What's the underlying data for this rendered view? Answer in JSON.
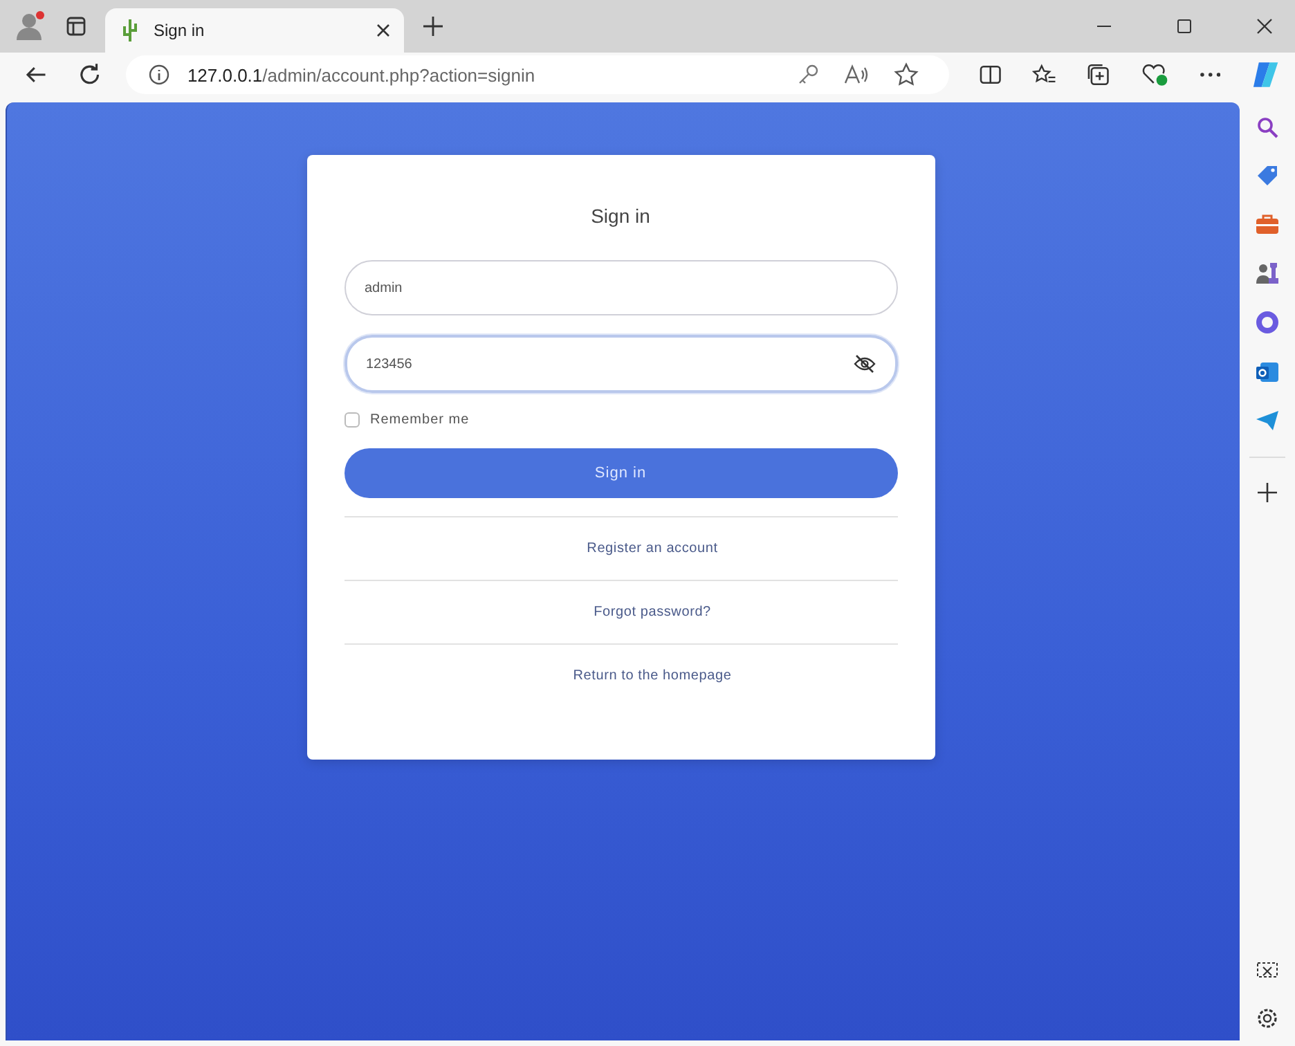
{
  "browser": {
    "tab": {
      "title": "Sign in",
      "selected": true
    },
    "address": {
      "host": "127.0.0.1",
      "path": "/admin/account.php?action=signin"
    }
  },
  "form": {
    "title": "Sign in",
    "fields": [
      {
        "kind": "text",
        "value": "admin",
        "focused": false
      },
      {
        "kind": "password",
        "value": "123456",
        "focused": true
      }
    ],
    "remember": {
      "label": "Remember me",
      "checked": false
    },
    "submit": "Sign in",
    "links": [
      "Register an account",
      "Forgot password?",
      "Return to the homepage"
    ]
  }
}
